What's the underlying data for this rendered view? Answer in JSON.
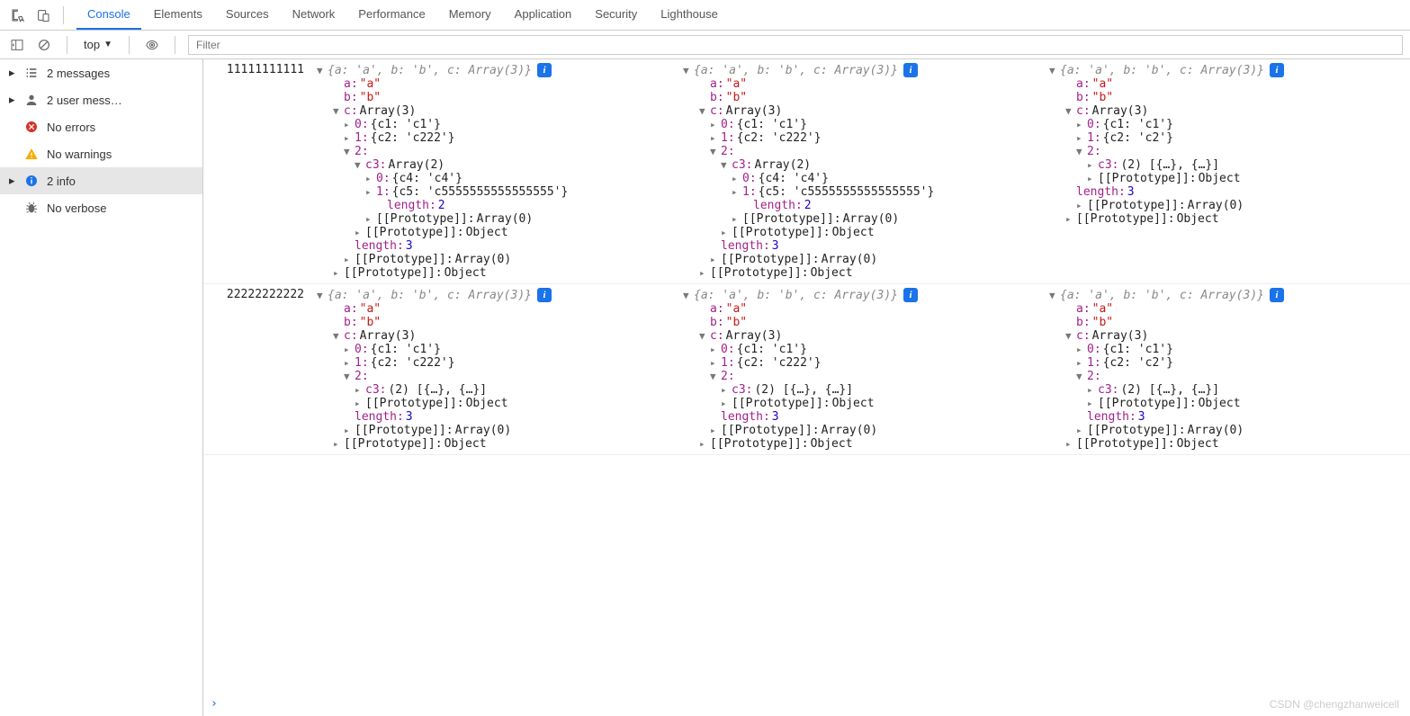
{
  "tabs": [
    "Console",
    "Elements",
    "Sources",
    "Network",
    "Performance",
    "Memory",
    "Application",
    "Security",
    "Lighthouse"
  ],
  "activeTab": "Console",
  "context": "top",
  "filterPlaceholder": "Filter",
  "sidebar": [
    {
      "icon": "list",
      "label": "2 messages",
      "caret": true
    },
    {
      "icon": "user",
      "label": "2 user mess…",
      "caret": true
    },
    {
      "icon": "error",
      "label": "No errors",
      "caret": false
    },
    {
      "icon": "warn",
      "label": "No warnings",
      "caret": false
    },
    {
      "icon": "info",
      "label": "2 info",
      "caret": true,
      "selected": true
    },
    {
      "icon": "bug",
      "label": "No verbose",
      "caret": false
    }
  ],
  "row1Label": "11111111111",
  "row2Label": "22222222222",
  "summary": "{a: 'a', b: 'b', c: Array(3)}",
  "aKey": "a",
  "aVal": "\"a\"",
  "bKey": "b",
  "bVal": "\"b\"",
  "cKey": "c",
  "cArr": "Array(3)",
  "i0": "0",
  "i0v": "{c1: 'c1'}",
  "i1": "1",
  "i1v": "{c2: 'c222'}",
  "i1vAlt": "{c2: 'c2'}",
  "i2": "2",
  "c3Key": "c3",
  "c3Arr": "Array(2)",
  "c3Short": "(2) [{…}, {…}]",
  "c30": "0",
  "c30v": "{c4: 'c4'}",
  "c31": "1",
  "c31v": "{c5: 'c5555555555555555'}",
  "lenKey": "length",
  "len2": "2",
  "len3": "3",
  "protoKey": "[[Prototype]]",
  "protoArr": "Array(0)",
  "protoObj": "Object",
  "watermark": "CSDN @chengzhanweicell"
}
